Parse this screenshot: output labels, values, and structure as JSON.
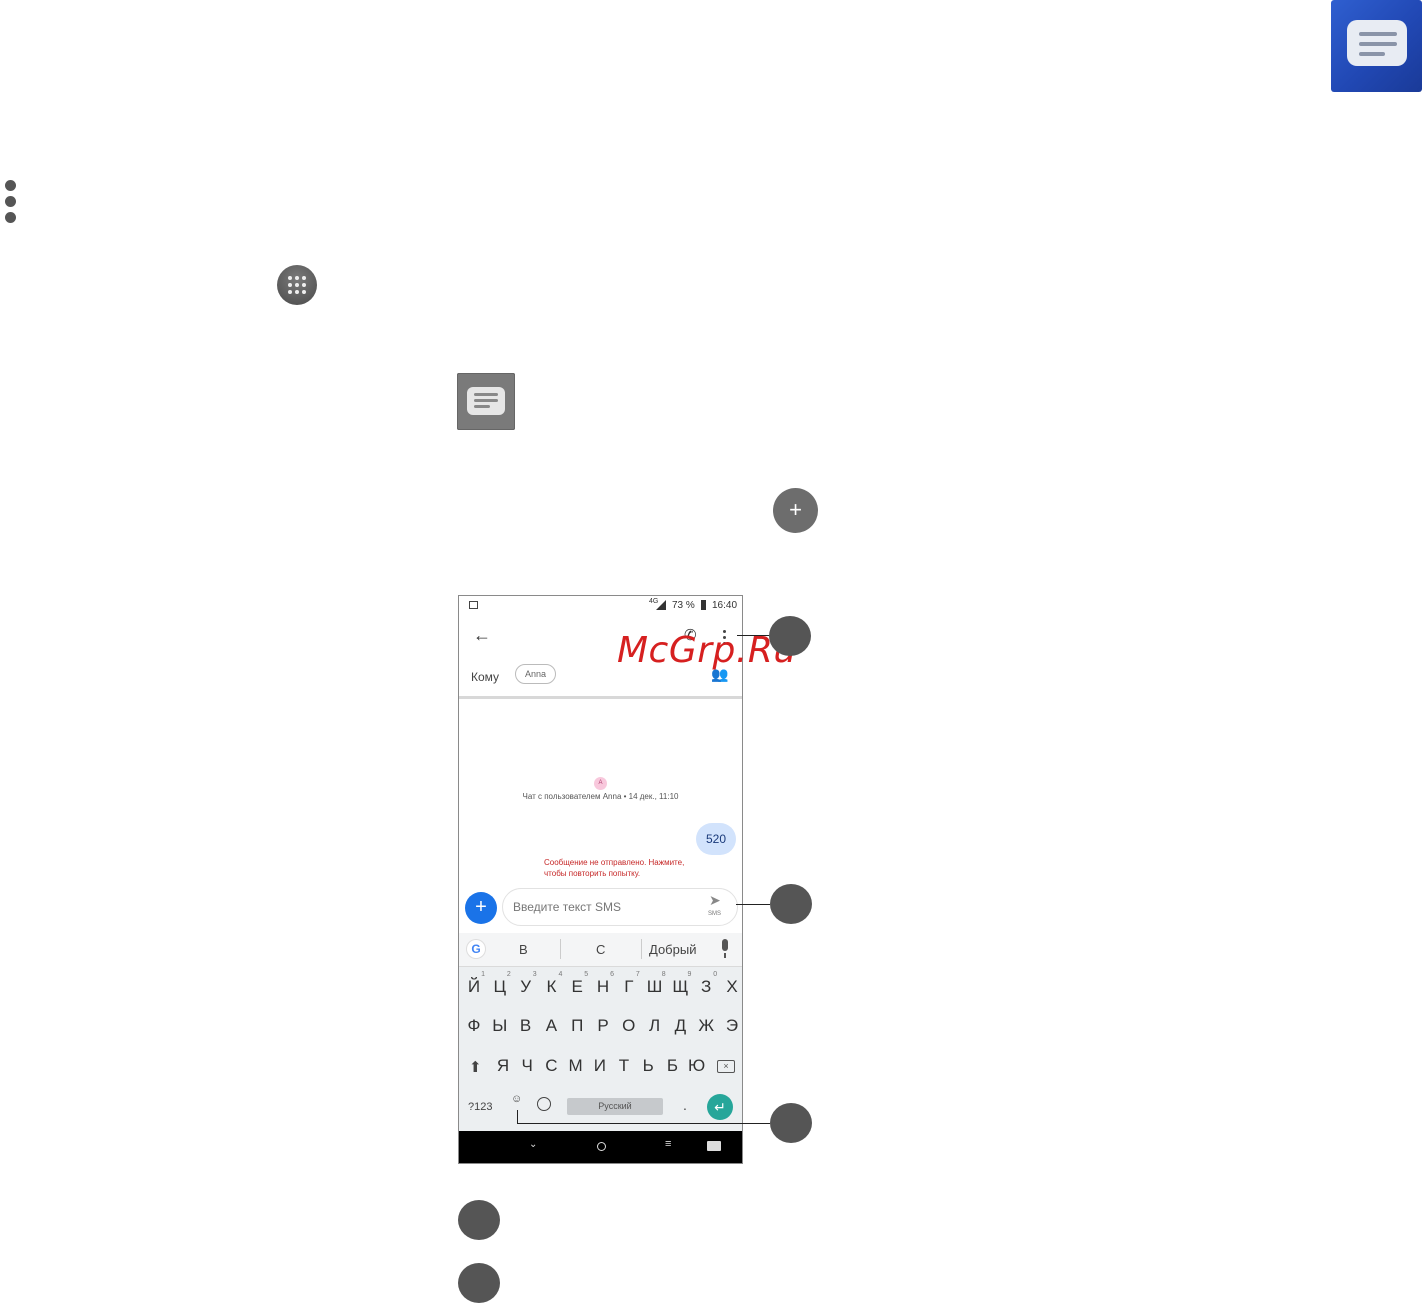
{
  "status_bar": {
    "network": "4G",
    "battery": "73 %",
    "time": "16:40"
  },
  "compose": {
    "to_label": "Кому",
    "recipient_chip": "Anna",
    "chat_header_initial": "A",
    "chat_header": "Чат с пользователем Anna • 14 дек., 11:10",
    "sent_message": "520",
    "error_text_line1": "Сообщение не отправлено. Нажмите,",
    "error_text_line2": "чтобы повторить попытку.",
    "input_placeholder": "Введите текст SMS",
    "send_sublabel": "SMS"
  },
  "keyboard": {
    "suggestions": [
      "В",
      "С",
      "Добрый"
    ],
    "row1": [
      "Й",
      "Ц",
      "У",
      "К",
      "Е",
      "Н",
      "Г",
      "Ш",
      "Щ",
      "З",
      "Х"
    ],
    "row1_digits": [
      "1",
      "2",
      "3",
      "4",
      "5",
      "6",
      "7",
      "8",
      "9",
      "0",
      ""
    ],
    "row2": [
      "Ф",
      "Ы",
      "В",
      "А",
      "П",
      "Р",
      "О",
      "Л",
      "Д",
      "Ж",
      "Э"
    ],
    "row3": [
      "Я",
      "Ч",
      "С",
      "М",
      "И",
      "Т",
      "Ь",
      "Б",
      "Ю"
    ],
    "symbols_key": "?123",
    "period_key": ".",
    "space_label": "Русский"
  },
  "watermark": "McGrp.Ru",
  "icons": [
    "messages-app-icon",
    "more-vert-icon",
    "apps-grid-icon",
    "new-message-icon",
    "back-arrow-icon",
    "phone-icon",
    "add-people-icon",
    "send-icon",
    "emoji-icon",
    "globe-icon",
    "mic-icon",
    "google-icon",
    "shift-icon",
    "backspace-icon",
    "enter-icon",
    "nav-back-icon",
    "nav-home-icon",
    "nav-recents-icon",
    "keyboard-icon"
  ],
  "colors": {
    "app_icon_blue": "#2148b4",
    "fab_blue": "#1a73e8",
    "error_red": "#c62828",
    "enter_teal": "#26a69a",
    "sent_bubble": "#d2e3fc"
  }
}
